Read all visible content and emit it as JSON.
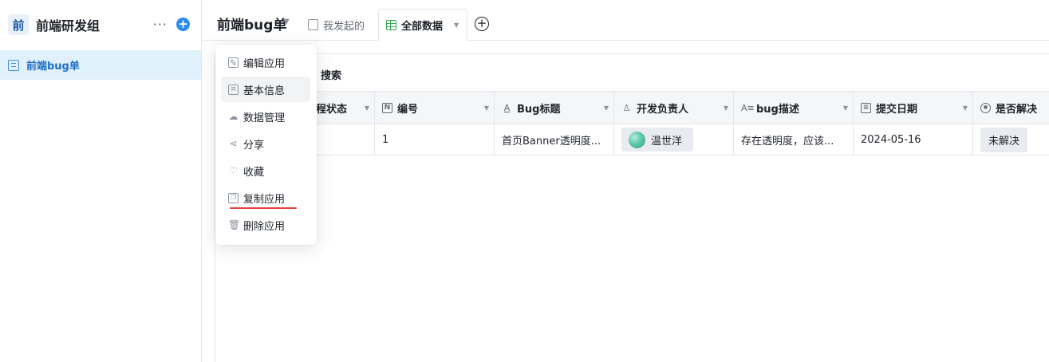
{
  "sidebar": {
    "workspace_logo": "前",
    "workspace_title": "前端研发组",
    "more_label": "···",
    "add_label": "+",
    "items": [
      {
        "label": "前端bug单"
      }
    ]
  },
  "header": {
    "app_title": "前端bug单",
    "tabs": [
      {
        "label": "我发起的"
      },
      {
        "label": "全部数据"
      }
    ],
    "add_tab_label": "+"
  },
  "toolbar": {
    "search_label": "搜索"
  },
  "table": {
    "columns": [
      {
        "label": "程状态",
        "icon": "status-icon"
      },
      {
        "label": "编号",
        "icon": "number-icon"
      },
      {
        "label": "Bug标题",
        "icon": "text-icon"
      },
      {
        "label": "开发负责人",
        "icon": "person-icon"
      },
      {
        "label": "bug描述",
        "icon": "long-text-icon"
      },
      {
        "label": "提交日期",
        "icon": "date-icon"
      },
      {
        "label": "是否解决",
        "icon": "option-icon"
      }
    ],
    "rows": [
      {
        "status": "",
        "number": "1",
        "title": "首页Banner透明度...",
        "owner": "温世洋",
        "description": "存在透明度，应该...",
        "date": "2024-05-16",
        "resolved": "未解决"
      }
    ]
  },
  "menu": {
    "items": [
      {
        "label": "编辑应用",
        "icon": "edit-icon"
      },
      {
        "label": "基本信息",
        "icon": "info-icon"
      },
      {
        "label": "数据管理",
        "icon": "data-manage-icon"
      },
      {
        "label": "分享",
        "icon": "share-icon"
      },
      {
        "label": "收藏",
        "icon": "heart-icon"
      },
      {
        "label": "复制应用",
        "icon": "copy-icon"
      },
      {
        "label": "删除应用",
        "icon": "trash-icon"
      }
    ],
    "highlighted": "基本信息",
    "annotated": "复制应用"
  },
  "colors": {
    "accent": "#2b8cf0",
    "sidebar_active_bg": "#e1f1fc",
    "annotation_red": "#e0403a",
    "grid_green": "#35a852"
  }
}
